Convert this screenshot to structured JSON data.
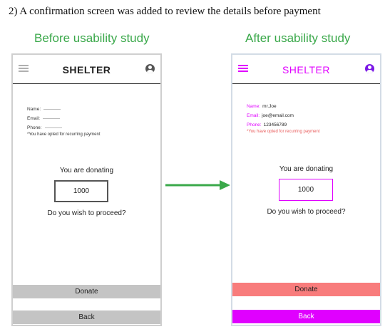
{
  "heading": "2)   A confirmation screen was added to review the details before payment",
  "panels": {
    "before": {
      "title": "Before usability study",
      "app_title": "SHELTER",
      "fields": [
        {
          "label": "Name:",
          "value": ""
        },
        {
          "label": "Email:",
          "value": ""
        },
        {
          "label": "Phone:",
          "value": ""
        }
      ],
      "recurring_note": "*You have opted for recurring payment",
      "donating_label": "You are donating",
      "amount": "1000",
      "proceed_question": "Do you wish to proceed?",
      "donate_label": "Donate",
      "back_label": "Back"
    },
    "after": {
      "title": "After usability study",
      "app_title": "SHELTER",
      "fields": [
        {
          "label": "Name:",
          "value": "mr.Joe"
        },
        {
          "label": "Email:",
          "value": "joe@email.com"
        },
        {
          "label": "Phone:",
          "value": "123456789"
        }
      ],
      "recurring_note": "*You have opted for recurring payment",
      "donating_label": "You are donating",
      "amount": "1000",
      "proceed_question": "Do you wish to proceed?",
      "donate_label": "Donate",
      "back_label": "Back"
    }
  },
  "colors": {
    "subtitle": "#3aa84a",
    "arrow": "#3aa84a",
    "after_accent": "#e000ff",
    "after_donate": "#f87c7c",
    "after_note": "#e85a5a",
    "before_button": "#c4c4c4"
  },
  "icons": {
    "menu": "hamburger-icon",
    "profile": "user-icon",
    "transition": "arrow-right-icon"
  }
}
